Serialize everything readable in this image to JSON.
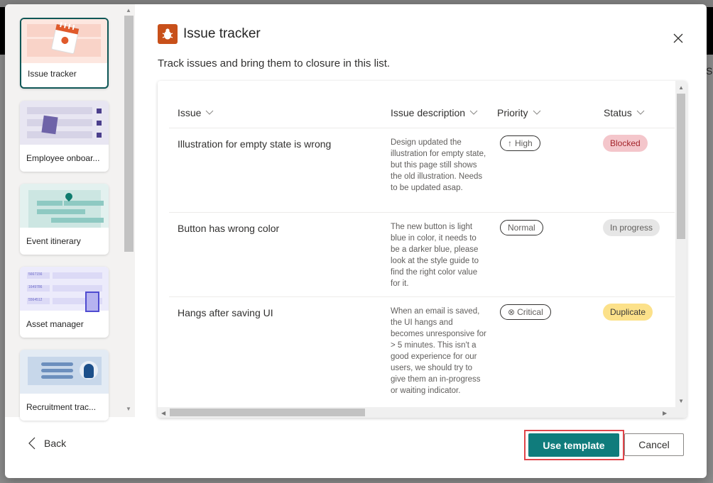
{
  "dialog": {
    "title": "Issue tracker",
    "title_icon": "bug-icon",
    "subtitle": "Track issues and bring them to closure in this list.",
    "close_icon": "close-icon"
  },
  "templates": [
    {
      "label": "Issue tracker",
      "icon": "calendar-bug-illustration",
      "selected": true
    },
    {
      "label": "Employee onboar...",
      "icon": "clipboard-checklist-illustration",
      "selected": false
    },
    {
      "label": "Event itinerary",
      "icon": "map-pin-itinerary-illustration",
      "selected": false
    },
    {
      "label": "Asset manager",
      "icon": "asset-tag-device-illustration",
      "selected": false
    },
    {
      "label": "Recruitment trac...",
      "icon": "candidate-profile-illustration",
      "selected": false
    }
  ],
  "asset_numbers": [
    "5667156",
    "1649786",
    "5564512"
  ],
  "preview": {
    "columns": [
      "Issue",
      "Issue description",
      "Priority",
      "Status"
    ],
    "rows": [
      {
        "issue": "Illustration for empty state is wrong",
        "description": "Design updated the illustration for empty state, but this page still shows the old illustration. Needs to be updated asap.",
        "priority": "High",
        "priority_icon": "arrow-up-icon",
        "status": "Blocked",
        "status_bg": "#f4c6cb",
        "status_fg": "#a4262c"
      },
      {
        "issue": "Button has wrong color",
        "description": "The new button is light blue in color, it needs to be a darker blue, please look at the style guide to find the right color value for it.",
        "priority": "Normal",
        "priority_icon": "",
        "status": "In progress",
        "status_bg": "#e6e6e6",
        "status_fg": "#605e5c"
      },
      {
        "issue": "Hangs after saving UI",
        "description": "When an email is saved, the UI hangs and becomes unresponsive for > 5 minutes. This isn't a good experience for our users, we should try to give them an in-progress or waiting indicator.",
        "priority": "Critical",
        "priority_icon": "circle-x-icon",
        "status": "Duplicate",
        "status_bg": "#fce18a",
        "status_fg": "#3b3a39"
      }
    ]
  },
  "footer": {
    "back_label": "Back",
    "use_template_label": "Use template",
    "cancel_label": "Cancel"
  },
  "colors": {
    "accent": "#107c7c",
    "selected_border": "#0f5757",
    "highlight_outline": "#e0454a",
    "title_icon_bg": "#c8501a"
  }
}
